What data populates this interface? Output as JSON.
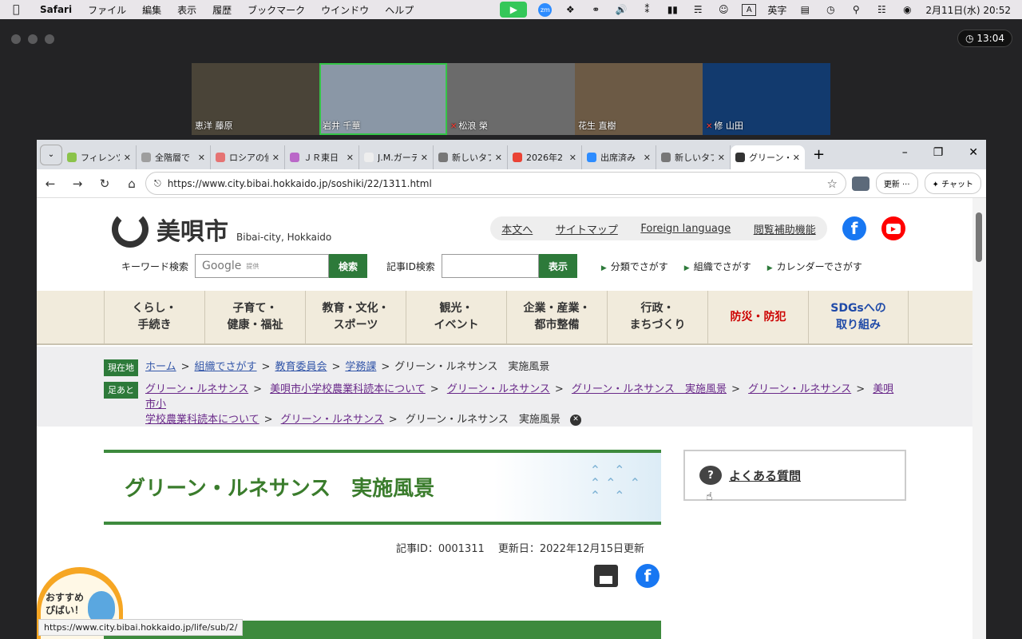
{
  "menubar": {
    "app": "Safari",
    "items": [
      "ファイル",
      "編集",
      "表示",
      "履歴",
      "ブックマーク",
      "ウインドウ",
      "ヘルプ"
    ],
    "input_mode": "英字",
    "input_badge": "A",
    "clock": "2月11日(水)  20:52"
  },
  "zoom": {
    "timer": "13:04",
    "participants": [
      {
        "name": "恵洋 藤原",
        "muted": false,
        "bg": "#4a4438"
      },
      {
        "name": "岩井 千華",
        "muted": false,
        "bg": "#8a97a6",
        "active": true
      },
      {
        "name": "松浪 榮",
        "muted": true,
        "bg": "#6b6b6b"
      },
      {
        "name": "花生 直樹",
        "muted": false,
        "bg": "#6c5a45"
      },
      {
        "name": "修 山田",
        "muted": true,
        "bg": "#123a6e"
      }
    ]
  },
  "browser": {
    "tabs": [
      {
        "label": "フィレンツェ",
        "fav": "#8bc34a"
      },
      {
        "label": "全階層で",
        "fav": "#9e9e9e"
      },
      {
        "label": "ロシアの偵",
        "fav": "#e57373"
      },
      {
        "label": "ＪＲ東日",
        "fav": "#ba68c8"
      },
      {
        "label": "J.M.ガーデ",
        "fav": "#eeeeee"
      },
      {
        "label": "新しいタブ",
        "fav": "#777777"
      },
      {
        "label": "2026年2",
        "fav": "#ea4335"
      },
      {
        "label": "出席済み",
        "fav": "#2d8cff"
      },
      {
        "label": "新しいタブ",
        "fav": "#777777"
      },
      {
        "label": "グリーン・ル",
        "fav": "#333333",
        "active": true
      }
    ],
    "url": "https://www.city.bibai.hokkaido.jp/soshiki/22/1311.html",
    "update_label": "更新 ···",
    "chat_label": "チャット"
  },
  "site": {
    "logo_text": "美唄市",
    "logo_sub": "Bibai-city, Hokkaido",
    "links": [
      "本文へ",
      "サイトマップ",
      "Foreign language",
      "閲覧補助機能"
    ],
    "keyword_label": "キーワード検索",
    "google": "Google",
    "google_sub": "提供",
    "search_btn": "検索",
    "id_label": "記事ID検索",
    "id_btn": "表示",
    "quick": [
      "分類でさがす",
      "組織でさがす",
      "カレンダーでさがす"
    ],
    "gnav": [
      "くらし・\n手続き",
      "子育て・\n健康・福祉",
      "教育・文化・\nスポーツ",
      "観光・\nイベント",
      "企業・産業・\n都市整備",
      "行政・\nまちづくり",
      "防災・防犯",
      "SDGsへの\n取り組み"
    ],
    "current_tag": "現在地",
    "current": [
      "ホーム",
      "組織でさがす",
      "教育委員会",
      "学務課"
    ],
    "current_last": "グリーン・ルネサンス　実施風景",
    "history_tag": "足あと",
    "history1": [
      "グリーン・ルネサンス",
      "美唄市小学校農業科読本について",
      "グリーン・ルネサンス",
      "グリーン・ルネサンス　実施風景",
      "グリーン・ルネサンス",
      "美唄市小"
    ],
    "history2": [
      "学校農業科読本について",
      "グリーン・ルネサンス"
    ],
    "history_last": "グリーン・ルネサンス　実施風景",
    "title": "グリーン・ルネサンス　実施風景",
    "meta": "記事ID：0001311　 更新日：2022年12月15日更新",
    "faq": "よくある質問",
    "osusume": "おすすめ\nぴばい！",
    "status_url": "https://www.city.bibai.hokkaido.jp/life/sub/2/"
  }
}
